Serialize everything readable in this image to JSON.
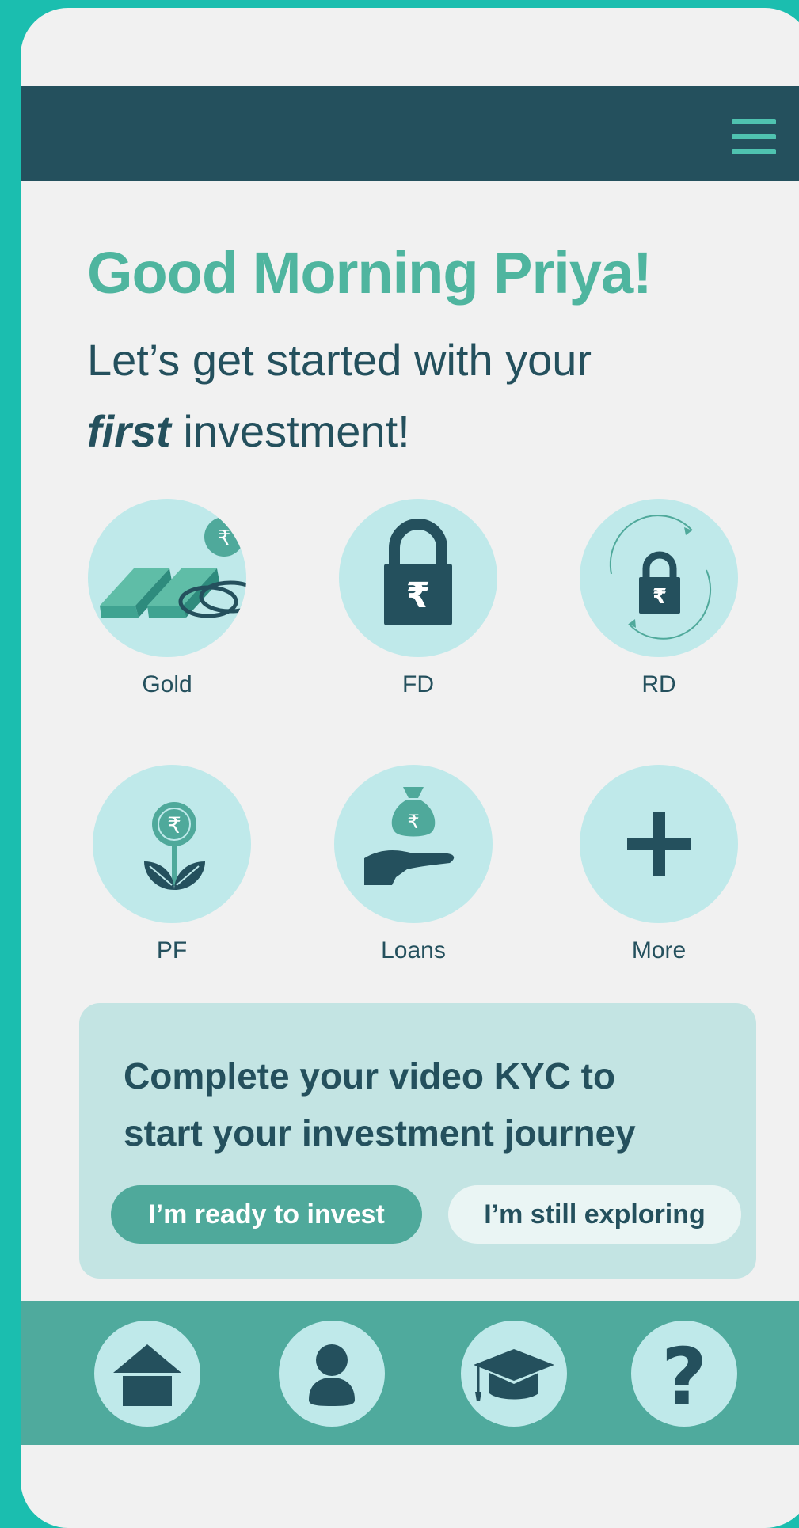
{
  "header": {
    "menu_icon": "hamburger-menu-icon"
  },
  "greeting": {
    "title": "Good Morning Priya!",
    "subtitle_line1": "Let’s get started with your",
    "subtitle_emphasis": "first",
    "subtitle_rest": " investment!"
  },
  "investments": [
    {
      "label": "Gold",
      "icon": "gold-bars-icon"
    },
    {
      "label": "FD",
      "icon": "padlock-rupee-icon"
    },
    {
      "label": "RD",
      "icon": "recurring-padlock-icon"
    },
    {
      "label": "PF",
      "icon": "rupee-plant-icon"
    },
    {
      "label": "Loans",
      "icon": "hand-money-bag-icon"
    },
    {
      "label": "More",
      "icon": "plus-icon"
    }
  ],
  "kyc": {
    "title": "Complete your video KYC to start your investment journey",
    "primary_button": "I’m ready to invest",
    "secondary_button": "I’m still exploring"
  },
  "bottom_nav": [
    {
      "icon": "home-icon"
    },
    {
      "icon": "profile-icon"
    },
    {
      "icon": "graduation-cap-icon"
    },
    {
      "icon": "help-question-icon"
    }
  ],
  "colors": {
    "background": "#1bbeaf",
    "screen": "#f1f1f1",
    "header": "#24505d",
    "accent": "#4fb59f",
    "icon_circle": "#bfe9ea",
    "card": "#c3e4e3",
    "nav_bar": "#4faa9d"
  }
}
